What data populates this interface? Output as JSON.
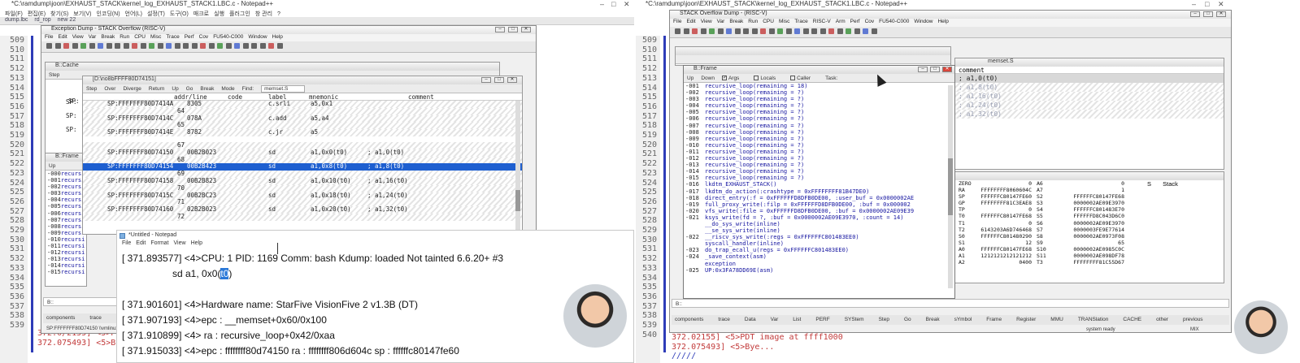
{
  "left_notepad": {
    "title": "*C:\\ramdump\\joon\\EXHAUST_STACK\\kernel_log_EXHAUST_STACK1.LBC.c - Notepad++",
    "menu": [
      "파일(F)",
      "편집(E)",
      "찾기(S)",
      "보기(V)",
      "인코딩(N)",
      "언어(L)",
      "설정(T)",
      "도구(O)",
      "매크로",
      "실행",
      "플러그인",
      "창 관리",
      "?"
    ],
    "tabs": [
      "dump.lbc",
      "rd_rop",
      "new 22"
    ],
    "line_numbers": [
      "509",
      "510",
      "511",
      "512",
      "513",
      "514",
      "515",
      "516",
      "517",
      "518",
      "519",
      "520",
      "521",
      "522",
      "523",
      "524",
      "525",
      "526",
      "527",
      "528",
      "529",
      "530",
      "531",
      "532",
      "533",
      "534",
      "535",
      "536",
      "537",
      "538",
      "539"
    ],
    "bottom_lines": [
      {
        "num": "538",
        "text": "372.0/2155] <5>Pl"
      },
      {
        "num": "539",
        "text": "372.075493] <5>By"
      }
    ]
  },
  "t32_left": {
    "title": "Exception Dump - STACK Overflow (RISC-V)",
    "menu": [
      "File",
      "Edit",
      "View",
      "Var",
      "Break",
      "Run",
      "CPU",
      "Misc",
      "Trace",
      "Perf",
      "Cov",
      "FU540-C000",
      "Window",
      "Help"
    ],
    "b_prompt": "B::",
    "bottom_tabs": [
      "components",
      "trace"
    ],
    "bottom_status": "SP:FFFFFFF80D74150 \\\\vmlinux\\f"
  },
  "disasm": {
    "title": "[D:\\no8bFFFF80D74151]",
    "buttons": [
      "Step",
      "Over",
      "Diverge",
      "Return",
      "Up",
      "Go",
      "Break",
      "Mode",
      "Find:"
    ],
    "find_value": "memset.S",
    "headers": {
      "addr": "addr/line",
      "code": "code",
      "label": "label",
      "mnemonic": "mnemonic",
      "comment": "comment"
    },
    "rows": [
      {
        "type": "code",
        "addr": "SP:FFFFFFF80D7414A",
        "code": "8305",
        "mn": "c.srli",
        "ops": "a5,0x1",
        "cm": ""
      },
      {
        "type": "line",
        "addr": "64"
      },
      {
        "type": "code",
        "addr": "SP:FFFFFFF80D7414C",
        "code": "078A",
        "mn": "c.add",
        "ops": "a5,a4",
        "cm": ""
      },
      {
        "type": "line",
        "addr": "65"
      },
      {
        "type": "code",
        "addr": "SP:FFFFFFF80D7414E",
        "code": "8782",
        "mn": "c.jr",
        "ops": "a5",
        "cm": ""
      },
      {
        "type": "gap"
      },
      {
        "type": "line",
        "addr": "67"
      },
      {
        "type": "code",
        "addr": "SP:FFFFFFF80D74150",
        "code": "00B2B023",
        "mn": "sd",
        "ops": "a1,0x0(t0)",
        "cm": "; a1,0(t0)"
      },
      {
        "type": "line",
        "addr": "68"
      },
      {
        "type": "sel",
        "addr": "SP:FFFFFFF80D74154",
        "code": "00B2B423",
        "mn": "sd",
        "ops": "a1,0x8(t0)",
        "cm": "; a1,8(t0)"
      },
      {
        "type": "line",
        "addr": "69"
      },
      {
        "type": "code",
        "addr": "SP:FFFFFFF80D74158",
        "code": "00B2B823",
        "mn": "sd",
        "ops": "a1,0x10(t0)",
        "cm": "; a1,16(t0)"
      },
      {
        "type": "line",
        "addr": "70"
      },
      {
        "type": "code",
        "addr": "SP:FFFFFFF80D7415C",
        "code": "00B2BC23",
        "mn": "sd",
        "ops": "a1,0x18(t0)",
        "cm": "; a1,24(t0)"
      },
      {
        "type": "line",
        "addr": "71"
      },
      {
        "type": "code",
        "addr": "SP:FFFFFFF80D74160",
        "code": "02B2B023",
        "mn": "sd",
        "ops": "a1,0x20(t0)",
        "cm": "; a1,32(t0)"
      },
      {
        "type": "line",
        "addr": "72"
      }
    ]
  },
  "bframe_left": {
    "title": "B::Frame",
    "button": "Up",
    "rows": [
      "-000",
      "-001",
      "-002",
      "-003",
      "-004",
      "-005",
      "-006",
      "-007",
      "-008",
      "-009",
      "-010",
      "-011",
      "-012",
      "-013",
      "-014",
      "-015"
    ],
    "row_text": "recursi"
  },
  "bcache_left": {
    "title": "B::Cache",
    "button": "Step",
    "sp_rows": [
      "SP:",
      "SP:",
      "SP:",
      "SP:"
    ]
  },
  "untitled_notepad": {
    "title": "*Untitled - Notepad",
    "menu": [
      "File",
      "Edit",
      "Format",
      "View",
      "Help"
    ],
    "lines": [
      {
        "ts": "[ 371.893577]",
        "text": "<4>CPU: 1 PID: 1169 Comm: bash Kdump: loaded Not tainted 6.6.20+ #3"
      },
      {
        "ts": "",
        "text": "sd a1, 0x0(",
        "hl": "t0",
        "tail": ")"
      },
      {
        "ts": "",
        "text": ""
      },
      {
        "ts": "[ 371.901601]",
        "text": "<4>Hardware name: StarFive VisionFive 2 v1.3B (DT)"
      },
      {
        "ts": "[ 371.907193]",
        "text": "<4>epc : __memset+0x60/0x100"
      },
      {
        "ts": "[ 371.910899]",
        "text": "<4> ra : recursive_loop+0x42/0xaa"
      },
      {
        "ts": "[ 371.915033]",
        "text": "<4>epc : ffffffff80d74150 ra : ffffffff806d604c sp : ffffffc80147fe60"
      }
    ]
  },
  "right_notepad": {
    "title": "*C:\\ramdump\\joon\\EXHAUST_STACK\\kernel_log_EXHAUST_STACK1.LBC.c - Notepad++",
    "line_numbers": [
      "509",
      "510",
      "511",
      "512",
      "513",
      "514",
      "515",
      "516",
      "517",
      "518",
      "519",
      "520",
      "521",
      "522",
      "523",
      "524",
      "525",
      "526",
      "527",
      "528",
      "529",
      "530",
      "531",
      "532",
      "533",
      "534",
      "535",
      "536",
      "537",
      "538",
      "539",
      "540"
    ],
    "bottom_lines": [
      {
        "num": "538",
        "text": "372.02155] <5>PDT image at ffff1000"
      },
      {
        "num": "539",
        "text": "372.075493] <5>Bye..."
      },
      {
        "num": "540",
        "text": "/////"
      }
    ]
  },
  "t32_right": {
    "title": "STACK Overflow Dump - (RISC-V)",
    "menu": [
      "File",
      "Edit",
      "View",
      "Var",
      "Break",
      "Run",
      "CPU",
      "Misc",
      "Trace",
      "RISC-V",
      "Arm",
      "Perf",
      "Cov",
      "FU540-C000",
      "Window",
      "Help"
    ],
    "b_prompt": "B::",
    "bottom_tabs": [
      "components",
      "trace",
      "Data",
      "Var",
      "List",
      "PERF",
      "SYStem",
      "Step",
      "Go",
      "Break",
      "sYmbol",
      "Frame",
      "Register",
      "MMU",
      "TRANSlation",
      "CACHE",
      "other",
      "previous"
    ],
    "status_right": "system ready",
    "status_mode": "MIX"
  },
  "bframe_right": {
    "title": "B::Frame",
    "buttons": [
      "Up",
      "Down"
    ],
    "checks": [
      {
        "label": "Args",
        "checked": true
      },
      {
        "label": "Locals",
        "checked": false
      },
      {
        "label": "Caller",
        "checked": false
      }
    ],
    "task_label": "Task:",
    "rows": [
      {
        "n": "-001",
        "t": "recursive_loop(remaining = 18)"
      },
      {
        "n": "-002",
        "t": "recursive_loop(remaining = ?)"
      },
      {
        "n": "-003",
        "t": "recursive_loop(remaining = ?)"
      },
      {
        "n": "-004",
        "t": "recursive_loop(remaining = ?)"
      },
      {
        "n": "-005",
        "t": "recursive_loop(remaining = ?)"
      },
      {
        "n": "-006",
        "t": "recursive_loop(remaining = ?)"
      },
      {
        "n": "-007",
        "t": "recursive_loop(remaining = ?)"
      },
      {
        "n": "-008",
        "t": "recursive_loop(remaining = ?)"
      },
      {
        "n": "-009",
        "t": "recursive_loop(remaining = ?)"
      },
      {
        "n": "-010",
        "t": "recursive_loop(remaining = ?)"
      },
      {
        "n": "-011",
        "t": "recursive_loop(remaining = ?)"
      },
      {
        "n": "-012",
        "t": "recursive_loop(remaining = ?)"
      },
      {
        "n": "-013",
        "t": "recursive_loop(remaining = ?)"
      },
      {
        "n": "-014",
        "t": "recursive_loop(remaining = ?)"
      },
      {
        "n": "-015",
        "t": "recursive_loop(remaining = ?)"
      },
      {
        "n": "-016",
        "t": "lkdtm_EXHAUST_STACK()"
      },
      {
        "n": "-017",
        "t": "lkdtm_do_action(:crashtype = 0xFFFFFFFF81B47DE0)"
      },
      {
        "n": "-018",
        "t": "direct_entry(:f = 0xFFFFFFD8DFB0DE00, :user_buf = 0x0000002AE"
      },
      {
        "n": "-019",
        "t": "full_proxy_write(:filp = 0xFFFFFFD8DFB0DE00, :buf = 0x000002"
      },
      {
        "n": "-020",
        "t": "vfs_write(:file = 0xFFFFFFD8DFB0DE00, :buf = 0x0000002AE09E39"
      },
      {
        "n": "-021",
        "t": "ksys_write(fd = ?, :buf = 0x0000002AE09E3970, :count = 14)"
      },
      {
        "n": "",
        "t": "__do_sys_write(inline)"
      },
      {
        "n": "",
        "t": "__se_sys_write(inline)"
      },
      {
        "n": "-022",
        "t": "__riscv_sys_write(:regs = 0xFFFFFFC801483EE0)"
      },
      {
        "n": "",
        "t": "syscall_handler(inline)"
      },
      {
        "n": "-023",
        "t": "do_trap_ecall_u(regs = 0xFFFFFFC801483EE0)"
      },
      {
        "n": "-024",
        "t": "_save_context(asm)"
      },
      {
        "n": "",
        "t": "exception"
      },
      {
        "n": "-025",
        "t": "UP:0x3FA78DD69E(asm)"
      }
    ]
  },
  "right_comment": {
    "title": "memset.S",
    "header": "comment",
    "rows": [
      "; a1,0(t0)",
      "; a1,8(t0)",
      "; a1,16(t0)",
      "; a1,24(t0)",
      "; a1,32(t0)"
    ]
  },
  "registers": {
    "stack_label": "Stack",
    "s_label": "S",
    "rows": [
      [
        "ZERO",
        "0",
        "A6",
        "0"
      ],
      [
        "RA",
        "FFFFFFFF8060604C",
        "A7",
        "1"
      ],
      [
        "SP",
        "FFFFFFC80147FE60",
        "S2",
        "FFFFFFC80147FE68"
      ],
      [
        "GP",
        "FFFFFFFF81C3EAE8",
        "S3",
        "0000002AE09E3970"
      ],
      [
        "TP",
        "0",
        "S4",
        "FFFFFFC801483E70"
      ],
      [
        "T0",
        "FFFFFFC80147FE68",
        "S5",
        "FFFFFFD8C043D6C0"
      ],
      [
        "T1",
        "0",
        "S6",
        "0000002AE09E3970"
      ],
      [
        "T2",
        "6143203A6D746468",
        "S7",
        "0000003FE9E77614"
      ],
      [
        "S0",
        "FFFFFFC801480290",
        "S8",
        "0000002AE0973F08"
      ],
      [
        "S1",
        "12",
        "S9",
        "65"
      ],
      [
        "A0",
        "FFFFFFC80147FE68",
        "S10",
        "0000002AE0985C0C"
      ],
      [
        "A1",
        "1212121212121212",
        "S11",
        "0000002AE098DF78"
      ],
      [
        "A2",
        "0400",
        "T3",
        "FFFFFFFF81C55D67"
      ]
    ]
  },
  "accent_colors": {
    "t32_line": "#2e3cb8",
    "selection": "#1e5fd0",
    "frame_text": "#1515a0",
    "hl_word": "#2a78d8"
  }
}
